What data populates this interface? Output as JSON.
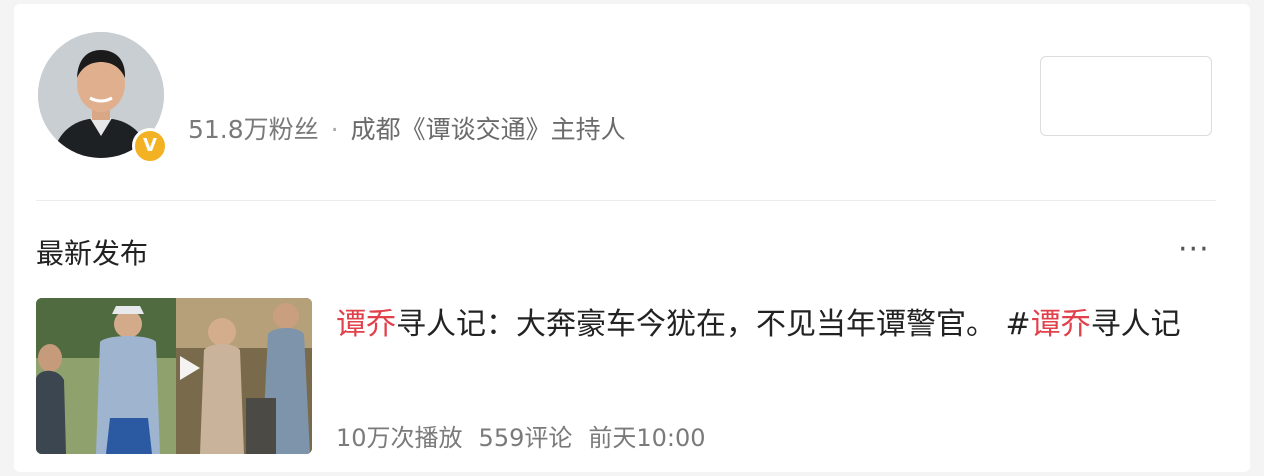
{
  "profile": {
    "followers": "51.8万粉丝",
    "separator": "·",
    "description": "成都《谭谈交通》主持人",
    "verified_badge": "V"
  },
  "section": {
    "title": "最新发布",
    "more_label": "···"
  },
  "post": {
    "title_parts": {
      "keyword_1": "谭乔",
      "text_1": "寻人记：大奔豪车今犹在，不见当年谭警官。 #",
      "keyword_2": "谭乔",
      "text_2": "寻人记"
    },
    "stats": {
      "plays": "10万次播放",
      "comments": "559评论",
      "time": "前天10:00"
    }
  },
  "colors": {
    "highlight": "#e0414b",
    "verified": "#f3b224"
  },
  "icons": [
    "verified-icon",
    "more-icon",
    "play-icon"
  ]
}
